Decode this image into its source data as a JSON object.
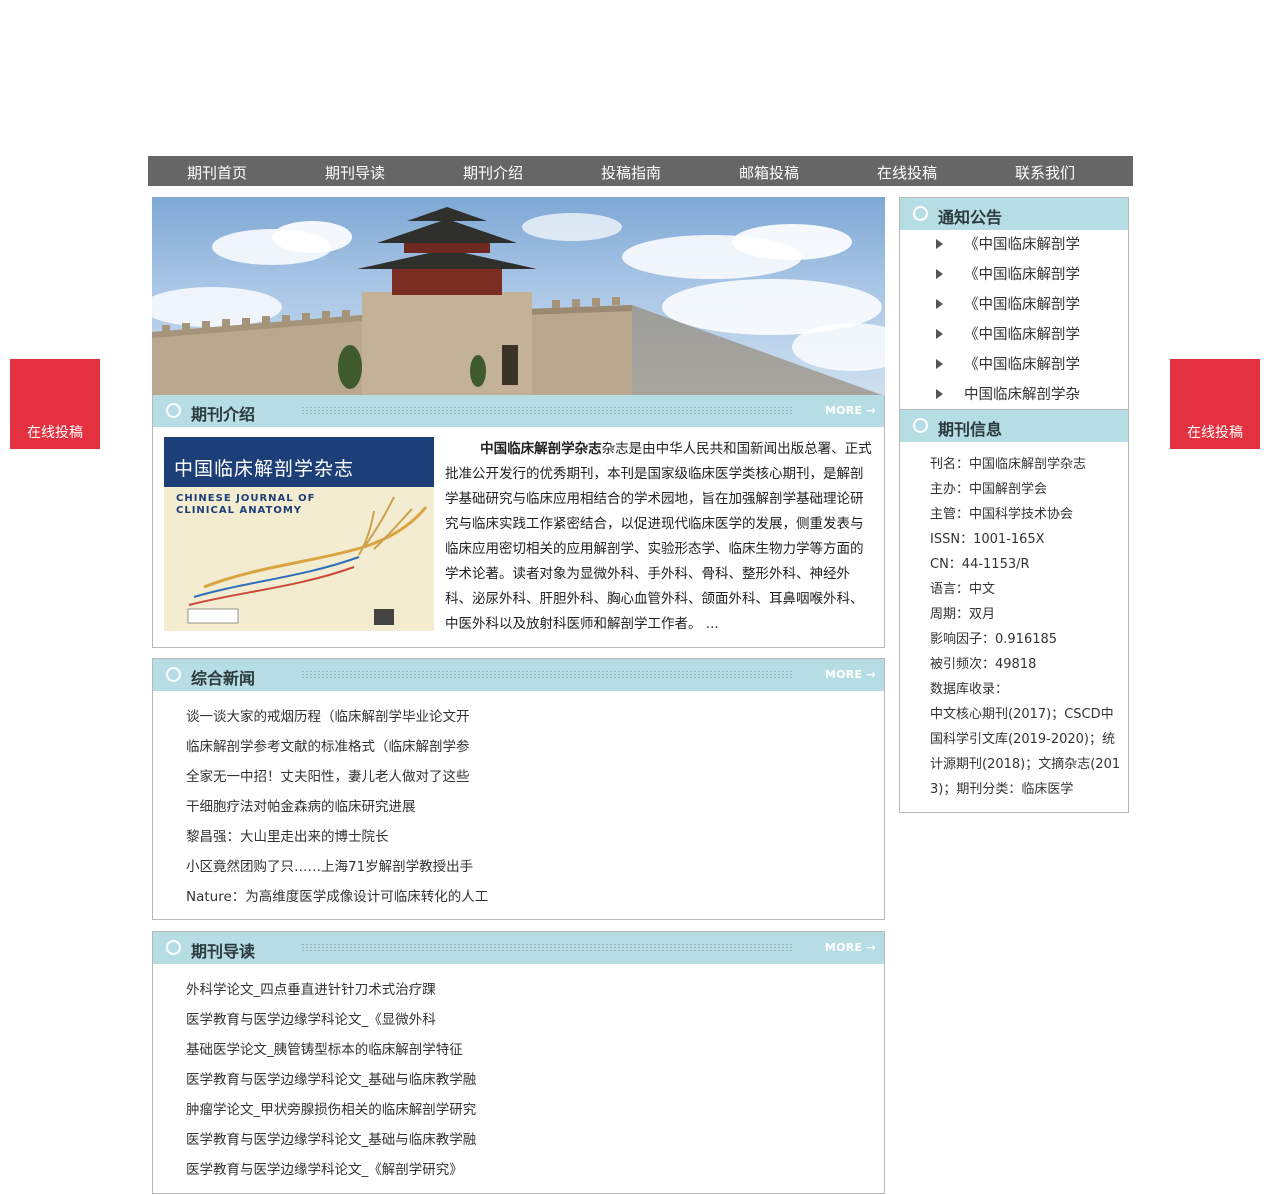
{
  "nav": [
    "期刊首页",
    "期刊导读",
    "期刊介绍",
    "投稿指南",
    "邮箱投稿",
    "在线投稿",
    "联系我们"
  ],
  "float_left_label": "在线投稿",
  "float_right_label": "在线投稿",
  "more_label": "MORE →",
  "intro": {
    "title": "期刊介绍",
    "cover": {
      "cn_title": "中国临床解剖学杂志",
      "en_title_line1": "CHINESE JOURNAL OF",
      "en_title_line2": "CLINICAL ANATOMY"
    },
    "lead": "中国临床解剖学杂志",
    "body": "杂志是由中华人民共和国新闻出版总署、正式批准公开发行的优秀期刊，本刊是国家级临床医学类核心期刊，是解剖学基础研究与临床应用相结合的学术园地，旨在加强解剖学基础理论研究与临床实践工作紧密结合，以促进现代临床医学的发展，侧重发表与临床应用密切相关的应用解剖学、实验形态学、临床生物力学等方面的学术论著。读者对象为显微外科、手外科、骨科、整形外科、神经外科、泌尿外科、肝胆外科、胸心血管外科、颌面外科、耳鼻咽喉外科、中医外科以及放射科医师和解剖学工作者。 ..."
  },
  "news": {
    "title": "综合新闻",
    "items": [
      "谈一谈大家的戒烟历程（临床解剖学毕业论文开",
      "临床解剖学参考文献的标准格式（临床解剖学参",
      "全家无一中招！丈夫阳性，妻儿老人做对了这些",
      "干细胞疗法对帕金森病的临床研究进展",
      "黎昌强：大山里走出来的博士院长",
      "小区竟然团购了只……上海71岁解剖学教授出手",
      "Nature：为高维度医学成像设计可临床转化的人工"
    ]
  },
  "guide": {
    "title": "期刊导读",
    "items": [
      "外科学论文_四点垂直进针针刀术式治疗踝",
      "医学教育与医学边缘学科论文_《显微外科",
      "基础医学论文_胰管铸型标本的临床解剖学特征",
      "医学教育与医学边缘学科论文_基础与临床教学融",
      "肿瘤学论文_甲状旁腺损伤相关的临床解剖学研究",
      "医学教育与医学边缘学科论文_基础与临床教学融",
      "医学教育与医学边缘学科论文_《解剖学研究》"
    ]
  },
  "notice": {
    "title": "通知公告",
    "items": [
      "《中国临床解剖学",
      "《中国临床解剖学",
      "《中国临床解剖学",
      "《中国临床解剖学",
      "《中国临床解剖学",
      "中国临床解剖学杂"
    ]
  },
  "info": {
    "title": "期刊信息",
    "rows": [
      "刊名：中国临床解剖学杂志",
      "主办：中国解剖学会",
      "主管：中国科学技术协会",
      "ISSN：1001-165X",
      "CN：44-1153/R",
      "语言：中文",
      "周期：双月",
      "影响因子：0.916185",
      "被引频次：49818",
      "数据库收录："
    ],
    "databases": "中文核心期刊(2017)；CSCD中国科学引文库(2019-2020)；统计源期刊(2018)；文摘杂志(2013)；期刊分类：临床医学"
  }
}
